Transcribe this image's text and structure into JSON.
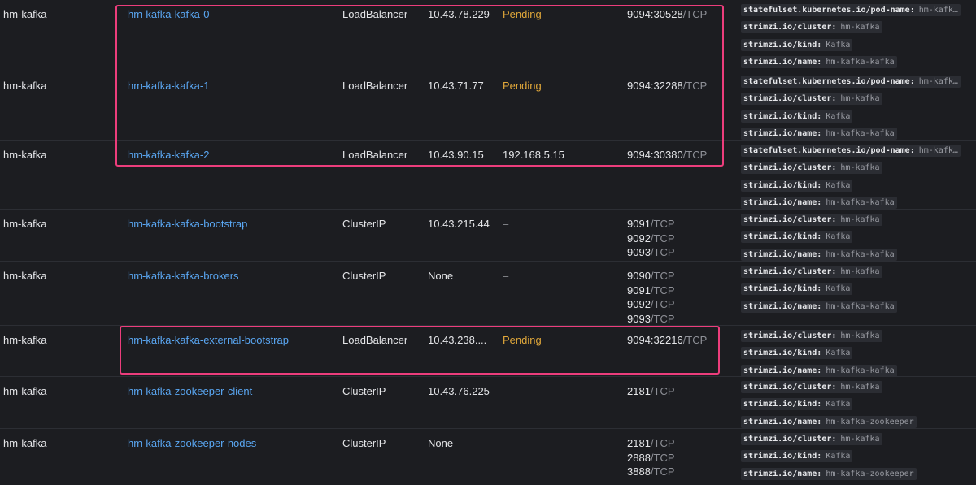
{
  "colors": {
    "background": "#1c1d21",
    "link": "#5aa7f3",
    "pending": "#e0a73a",
    "highlight": "#ec3d7c"
  },
  "services": [
    {
      "namespace": "hm-kafka",
      "name": "hm-kafka-kafka-0",
      "type": "LoadBalancer",
      "cluster_ip": "10.43.78.229",
      "external_ip": "Pending",
      "external_ip_status": "pending",
      "ports": [
        {
          "num": "9094:30528",
          "unit": "/TCP"
        }
      ],
      "labels": [
        {
          "key": "statefulset.kubernetes.io/pod-name:",
          "value": "hm-kafk…"
        },
        {
          "key": "strimzi.io/cluster:",
          "value": "hm-kafka"
        },
        {
          "key": "strimzi.io/kind:",
          "value": "Kafka"
        },
        {
          "key": "strimzi.io/name:",
          "value": "hm-kafka-kafka"
        }
      ]
    },
    {
      "namespace": "hm-kafka",
      "name": "hm-kafka-kafka-1",
      "type": "LoadBalancer",
      "cluster_ip": "10.43.71.77",
      "external_ip": "Pending",
      "external_ip_status": "pending",
      "ports": [
        {
          "num": "9094:32288",
          "unit": "/TCP"
        }
      ],
      "labels": [
        {
          "key": "statefulset.kubernetes.io/pod-name:",
          "value": "hm-kafk…"
        },
        {
          "key": "strimzi.io/cluster:",
          "value": "hm-kafka"
        },
        {
          "key": "strimzi.io/kind:",
          "value": "Kafka"
        },
        {
          "key": "strimzi.io/name:",
          "value": "hm-kafka-kafka"
        }
      ]
    },
    {
      "namespace": "hm-kafka",
      "name": "hm-kafka-kafka-2",
      "type": "LoadBalancer",
      "cluster_ip": "10.43.90.15",
      "external_ip": "192.168.5.15",
      "external_ip_status": "ok",
      "ports": [
        {
          "num": "9094:30380",
          "unit": "/TCP"
        }
      ],
      "labels": [
        {
          "key": "statefulset.kubernetes.io/pod-name:",
          "value": "hm-kafk…"
        },
        {
          "key": "strimzi.io/cluster:",
          "value": "hm-kafka"
        },
        {
          "key": "strimzi.io/kind:",
          "value": "Kafka"
        },
        {
          "key": "strimzi.io/name:",
          "value": "hm-kafka-kafka"
        }
      ]
    },
    {
      "namespace": "hm-kafka",
      "name": "hm-kafka-kafka-bootstrap",
      "type": "ClusterIP",
      "cluster_ip": "10.43.215.44",
      "external_ip": "–",
      "external_ip_status": "none",
      "ports": [
        {
          "num": "9091",
          "unit": "/TCP"
        },
        {
          "num": "9092",
          "unit": "/TCP"
        },
        {
          "num": "9093",
          "unit": "/TCP"
        }
      ],
      "labels": [
        {
          "key": "strimzi.io/cluster:",
          "value": "hm-kafka"
        },
        {
          "key": "strimzi.io/kind:",
          "value": "Kafka"
        },
        {
          "key": "strimzi.io/name:",
          "value": "hm-kafka-kafka"
        }
      ]
    },
    {
      "namespace": "hm-kafka",
      "name": "hm-kafka-kafka-brokers",
      "type": "ClusterIP",
      "cluster_ip": "None",
      "external_ip": "–",
      "external_ip_status": "none",
      "ports": [
        {
          "num": "9090",
          "unit": "/TCP"
        },
        {
          "num": "9091",
          "unit": "/TCP"
        },
        {
          "num": "9092",
          "unit": "/TCP"
        },
        {
          "num": "9093",
          "unit": "/TCP"
        }
      ],
      "labels": [
        {
          "key": "strimzi.io/cluster:",
          "value": "hm-kafka"
        },
        {
          "key": "strimzi.io/kind:",
          "value": "Kafka"
        },
        {
          "key": "strimzi.io/name:",
          "value": "hm-kafka-kafka"
        }
      ]
    },
    {
      "namespace": "hm-kafka",
      "name": "hm-kafka-kafka-external-bootstrap",
      "type": "LoadBalancer",
      "cluster_ip": "10.43.238....",
      "external_ip": "Pending",
      "external_ip_status": "pending",
      "ports": [
        {
          "num": "9094:32216",
          "unit": "/TCP"
        }
      ],
      "labels": [
        {
          "key": "strimzi.io/cluster:",
          "value": "hm-kafka"
        },
        {
          "key": "strimzi.io/kind:",
          "value": "Kafka"
        },
        {
          "key": "strimzi.io/name:",
          "value": "hm-kafka-kafka"
        }
      ]
    },
    {
      "namespace": "hm-kafka",
      "name": "hm-kafka-zookeeper-client",
      "type": "ClusterIP",
      "cluster_ip": "10.43.76.225",
      "external_ip": "–",
      "external_ip_status": "none",
      "ports": [
        {
          "num": "2181",
          "unit": "/TCP"
        }
      ],
      "labels": [
        {
          "key": "strimzi.io/cluster:",
          "value": "hm-kafka"
        },
        {
          "key": "strimzi.io/kind:",
          "value": "Kafka"
        },
        {
          "key": "strimzi.io/name:",
          "value": "hm-kafka-zookeeper"
        }
      ]
    },
    {
      "namespace": "hm-kafka",
      "name": "hm-kafka-zookeeper-nodes",
      "type": "ClusterIP",
      "cluster_ip": "None",
      "external_ip": "–",
      "external_ip_status": "none",
      "ports": [
        {
          "num": "2181",
          "unit": "/TCP"
        },
        {
          "num": "2888",
          "unit": "/TCP"
        },
        {
          "num": "3888",
          "unit": "/TCP"
        }
      ],
      "labels": [
        {
          "key": "strimzi.io/cluster:",
          "value": "hm-kafka"
        },
        {
          "key": "strimzi.io/kind:",
          "value": "Kafka"
        },
        {
          "key": "strimzi.io/name:",
          "value": "hm-kafka-zookeeper"
        }
      ]
    }
  ]
}
